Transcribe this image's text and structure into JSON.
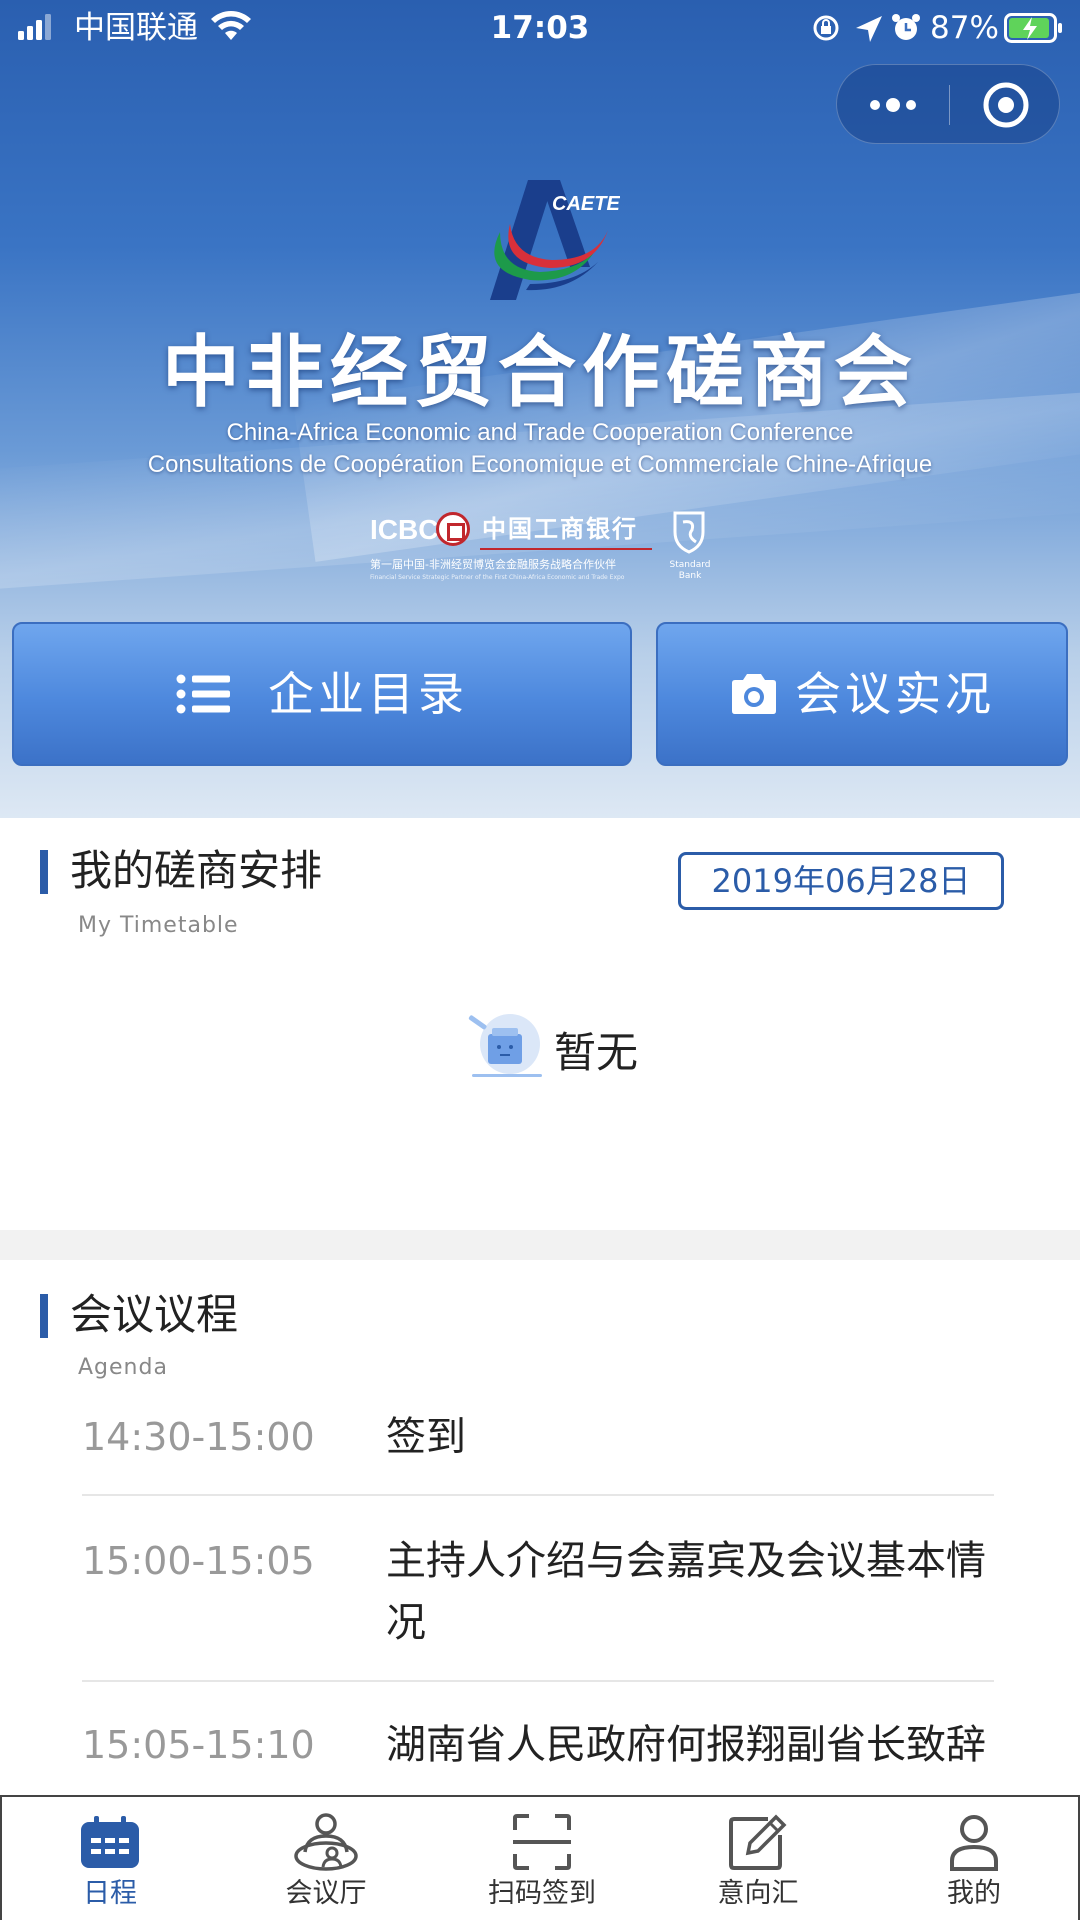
{
  "status_bar": {
    "carrier": "中国联通",
    "time": "17:03",
    "battery": "87%"
  },
  "banner": {
    "logo_text": "CAETE",
    "title_cn": "中非经贸合作磋商会",
    "title_en": "China-Africa Economic and Trade Cooperation Conference",
    "title_fr": "Consultations de Coopération Economique et Commerciale Chine-Afrique",
    "sponsor": {
      "icbc": "ICBC",
      "bank_name": "中国工商银行",
      "partner_cn": "第一届中国-非洲经贸博览会金融服务战略合作伙伴",
      "partner_en": "Financial Service Strategic Partner of the First China-Africa Economic and Trade Expo",
      "standard_bank": "Standard Bank"
    }
  },
  "actions": {
    "directory_label": "企业目录",
    "live_label": "会议实况"
  },
  "timetable": {
    "title": "我的磋商安排",
    "subtitle": "My Timetable",
    "date": "2019年06月28日",
    "empty_text": "暂无"
  },
  "agenda": {
    "title": "会议议程",
    "subtitle": "Agenda",
    "items": [
      {
        "time": "14:30-15:00",
        "desc": "签到"
      },
      {
        "time": "15:00-15:05",
        "desc": "主持人介绍与会嘉宾及会议基本情况"
      },
      {
        "time": "15:05-15:10",
        "desc": "湖南省人民政府何报翔副省长致辞"
      }
    ]
  },
  "tabbar": {
    "items": [
      {
        "label": "日程",
        "icon": "calendar-icon"
      },
      {
        "label": "会议厅",
        "icon": "meeting-hall-icon"
      },
      {
        "label": "扫码签到",
        "icon": "scan-icon"
      },
      {
        "label": "意向汇",
        "icon": "edit-icon"
      },
      {
        "label": "我的",
        "icon": "user-icon"
      }
    ],
    "active_index": 0
  },
  "colors": {
    "accent": "#2b5ca8",
    "button_blue": "#4d88dd"
  }
}
